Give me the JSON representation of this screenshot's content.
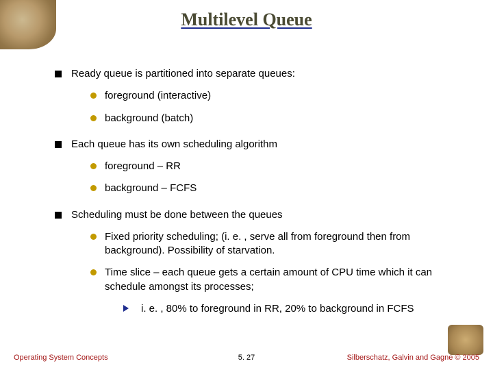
{
  "title": "Multilevel Queue",
  "bullets": {
    "b1": {
      "text": "Ready queue is partitioned into separate queues:",
      "sub": {
        "s1": "foreground (interactive)",
        "s2": "background (batch)"
      }
    },
    "b2": {
      "text": "Each queue has its own scheduling algorithm",
      "sub": {
        "s1": "foreground – RR",
        "s2": "background – FCFS"
      }
    },
    "b3": {
      "text": "Scheduling must be done between the queues",
      "sub": {
        "s1": "Fixed priority scheduling; (i. e. , serve all from foreground then from background).  Possibility of starvation.",
        "s2": "Time slice – each queue gets a certain amount of CPU time which it can schedule amongst its processes;",
        "s2sub": {
          "t1": "i. e. , 80% to foreground in RR, 20% to background in FCFS"
        }
      }
    }
  },
  "footer": {
    "left": "Operating System Concepts",
    "center": "5. 27",
    "right": "Silberschatz, Galvin and Gagne © 2005"
  }
}
